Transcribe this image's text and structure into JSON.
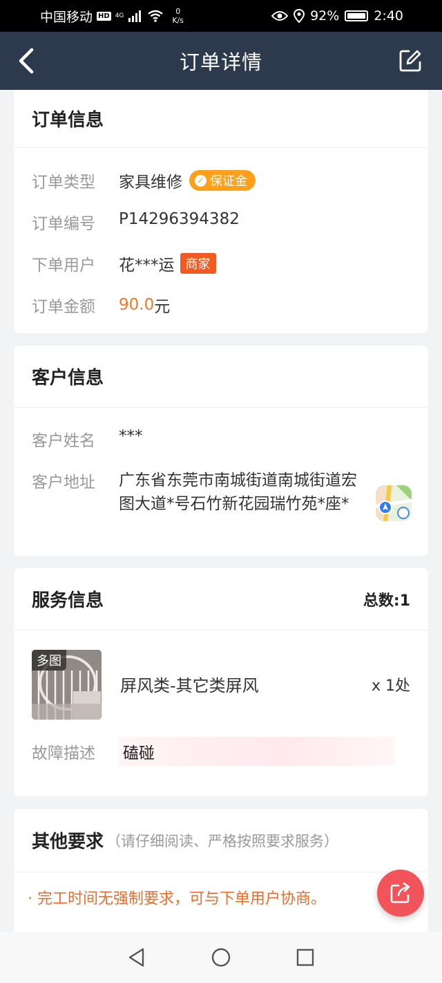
{
  "status_bar": {
    "carrier": "中国移动",
    "hd": "HD",
    "network": "4G",
    "speed_value": "0",
    "speed_unit": "K/s",
    "battery": "92%",
    "time": "2:40"
  },
  "nav": {
    "title": "订单详情"
  },
  "order_info": {
    "title": "订单信息",
    "type_label": "订单类型",
    "type_value": "家具维修",
    "type_badge": "保证金",
    "number_label": "订单编号",
    "number_value": "P14296394382",
    "user_label": "下单用户",
    "user_value": "花***运",
    "user_badge": "商家",
    "amount_label": "订单金额",
    "amount_value": "90.0",
    "amount_unit": "元"
  },
  "customer_info": {
    "title": "客户信息",
    "name_label": "客户姓名",
    "name_value": "***",
    "address_label": "客户地址",
    "address_value": "广东省东莞市南城街道南城街道宏图大道*号石竹新花园瑞竹苑*座*"
  },
  "service_info": {
    "title": "服务信息",
    "total": "总数:1",
    "thumb_tag": "多图",
    "item_name": "屏风类-其它类屏风",
    "item_qty": "x 1处",
    "fault_label": "故障描述",
    "fault_value": "磕碰"
  },
  "other_requirements": {
    "title": "其他要求",
    "subtitle": "（请仔细阅读、严格按照要求服务）",
    "item": "· 完工时间无强制要求，可与下单用户协商。"
  },
  "colors": {
    "nav_bg": "#2d3a4d",
    "accent_orange": "#f07828",
    "deposit_badge": "#ff9f1a",
    "merchant_badge": "#f25a22",
    "fab": "#f2545b"
  }
}
